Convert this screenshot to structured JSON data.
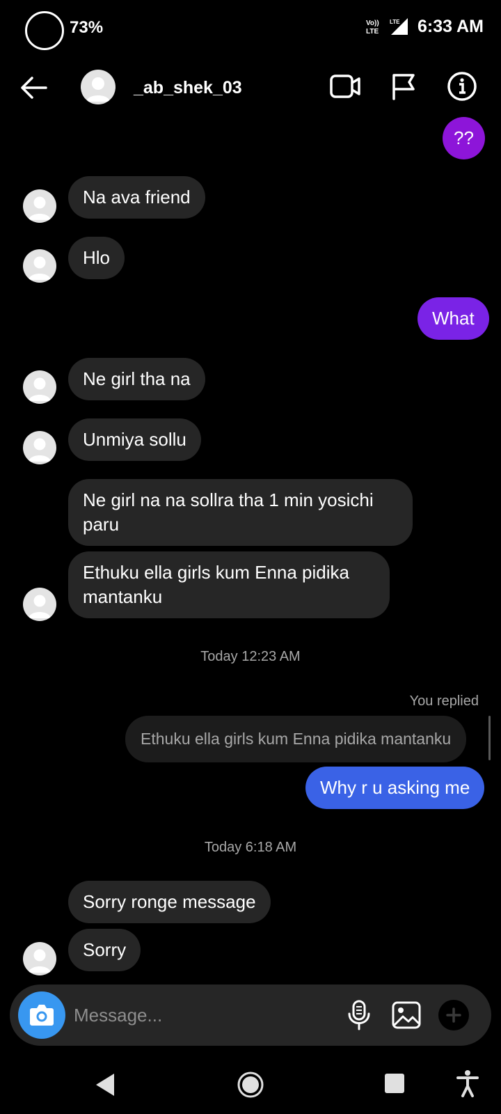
{
  "status_bar": {
    "battery_percent": "73%",
    "network_label": "Vo))\nLTE",
    "lte_label": "LTE",
    "time": "6:33 AM"
  },
  "header": {
    "username": "_ab_shek_03",
    "icons": [
      "back-arrow-icon",
      "video-call-icon",
      "flag-icon",
      "info-icon"
    ]
  },
  "messages": [
    {
      "dir": "out",
      "text": "??"
    },
    {
      "dir": "in",
      "text": "Na ava friend"
    },
    {
      "dir": "in",
      "text": "Hlo"
    },
    {
      "dir": "out",
      "text": "What"
    },
    {
      "dir": "in",
      "text": "Ne girl tha na"
    },
    {
      "dir": "in",
      "text": "Unmiya sollu"
    },
    {
      "dir": "in",
      "text": "Ne girl na na sollra tha 1 min yosichi paru"
    },
    {
      "dir": "in",
      "text": "Ethuku ella girls kum  Enna pidika mantanku"
    },
    {
      "dir": "out",
      "text": "Why r u asking me"
    },
    {
      "dir": "in",
      "text": "Sorry ronge message"
    },
    {
      "dir": "in",
      "text": "Sorry"
    }
  ],
  "timestamps": {
    "first": "Today 12:23 AM",
    "second": "Today 6:18 AM"
  },
  "reply": {
    "label": "You replied",
    "quoted_text": "Ethuku ella girls kum  Enna pidika mantanku"
  },
  "composer": {
    "placeholder": "Message...",
    "icons": [
      "camera-icon",
      "microphone-icon",
      "gallery-icon",
      "plus-icon"
    ]
  },
  "colors": {
    "background": "#000000",
    "incoming_bubble": "#262626",
    "outgoing_purple": "#8d15d9",
    "outgoing_violet": "#7a23e6",
    "outgoing_blue": "#3a62e6",
    "camera_button": "#3897f0",
    "muted_text": "#a8a8a8"
  }
}
